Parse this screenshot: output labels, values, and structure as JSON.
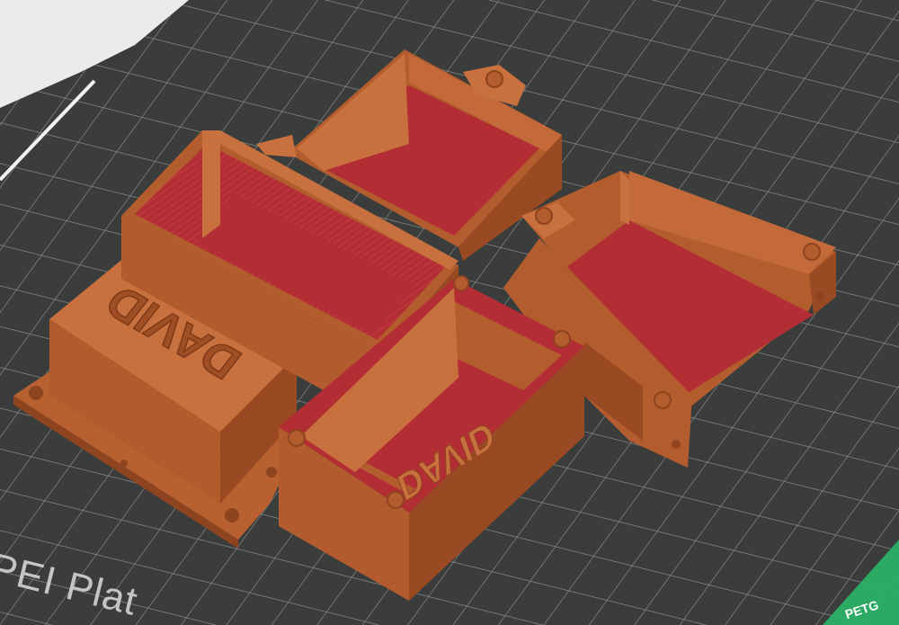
{
  "scene": {
    "bed_label": "PEI Plat",
    "filament_tag": "PETG",
    "box_lid_text": "DAVID",
    "box_floor_text": "DAVID"
  },
  "colors": {
    "background": "#e9eceb",
    "bed": "#3b3d3c",
    "grid": "#8b8d8c",
    "model_side": "#b35c2e",
    "model_side_dark": "#9a4a22",
    "model_top": "#c8703e",
    "infill": "#b32d34",
    "edge_accent": "#2bb567"
  }
}
